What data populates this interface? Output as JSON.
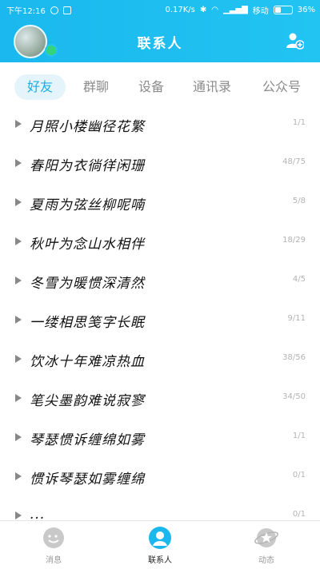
{
  "status_bar": {
    "time": "下午12:16",
    "speed": "0.17K/s",
    "carrier": "移动",
    "battery": "36%"
  },
  "header": {
    "title": "联系人"
  },
  "tabs": [
    {
      "label": "好友",
      "active": true
    },
    {
      "label": "群聊",
      "active": false
    },
    {
      "label": "设备",
      "active": false
    },
    {
      "label": "通讯录",
      "active": false
    },
    {
      "label": "公众号",
      "active": false
    }
  ],
  "groups": [
    {
      "name": "月照小楼幽径花繁",
      "count": "1/1"
    },
    {
      "name": "春阳为衣徜徉闲珊",
      "count": "48/75"
    },
    {
      "name": "夏雨为弦丝柳呢喃",
      "count": "5/8"
    },
    {
      "name": "秋叶为念山水相伴",
      "count": "18/29"
    },
    {
      "name": "冬雪为暖惯深清然",
      "count": "4/5"
    },
    {
      "name": "一缕相思笺字长眠",
      "count": "9/11"
    },
    {
      "name": "饮冰十年难凉热血",
      "count": "38/56"
    },
    {
      "name": "笔尖墨韵难说寂寥",
      "count": "34/50"
    },
    {
      "name": "琴瑟惯诉缠绵如雾",
      "count": "1/1"
    },
    {
      "name": "惯诉琴瑟如雾缠绵",
      "count": "0/1"
    },
    {
      "name": "...",
      "count": "0/1"
    }
  ],
  "bottom_nav": [
    {
      "label": "消息",
      "active": false
    },
    {
      "label": "联系人",
      "active": true
    },
    {
      "label": "动态",
      "active": false
    }
  ],
  "colors": {
    "header": "#1ab8ee",
    "accent": "#18aee6",
    "online": "#33d47a"
  }
}
